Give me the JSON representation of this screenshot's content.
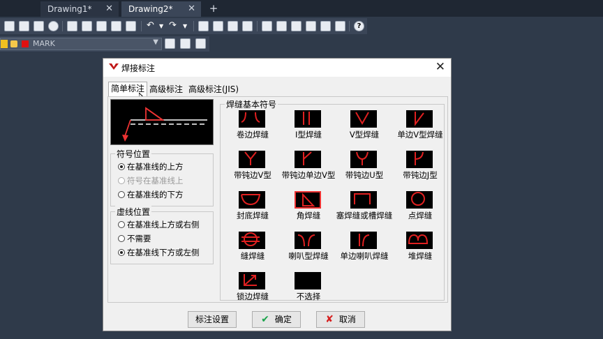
{
  "tabs": [
    {
      "label": "Drawing1*",
      "active": false
    },
    {
      "label": "Drawing2*",
      "active": true
    }
  ],
  "new_tab_label": "+",
  "layer": {
    "name": "MARK",
    "color": "#e01010"
  },
  "dialog": {
    "title": "焊接标注",
    "close": "✕",
    "tabs": [
      "简单标注",
      "高级标注",
      "高级标注(JIS)"
    ],
    "symbol_position": {
      "legend": "符号位置",
      "options": [
        {
          "label": "在基准线的上方",
          "checked": true,
          "disabled": false
        },
        {
          "label": "符号在基准线上",
          "checked": false,
          "disabled": true
        },
        {
          "label": "在基准线的下方",
          "checked": false,
          "disabled": false
        }
      ]
    },
    "dashed_position": {
      "legend": "虚线位置",
      "options": [
        {
          "label": "在基准线上方或右侧",
          "checked": false
        },
        {
          "label": "不需要",
          "checked": false
        },
        {
          "label": "在基准线下方或左侧",
          "checked": true
        }
      ]
    },
    "symbols_legend": "焊缝基本符号",
    "symbols": [
      {
        "label": "卷边焊缝",
        "icon": "flange-weld-icon"
      },
      {
        "label": "I型焊缝",
        "icon": "i-weld-icon"
      },
      {
        "label": "V型焊缝",
        "icon": "v-weld-icon"
      },
      {
        "label": "单边V型焊缝",
        "icon": "bevel-weld-icon"
      },
      {
        "label": "带钝边V型",
        "icon": "y-weld-icon"
      },
      {
        "label": "带钝边单边V型",
        "icon": "bevel-root-weld-icon"
      },
      {
        "label": "带钝边U型",
        "icon": "u-weld-icon"
      },
      {
        "label": "带钝边J型",
        "icon": "j-weld-icon"
      },
      {
        "label": "封底焊缝",
        "icon": "backing-weld-icon"
      },
      {
        "label": "角焊缝",
        "icon": "fillet-weld-icon",
        "selected": true
      },
      {
        "label": "塞焊缝或槽焊缝",
        "icon": "plug-weld-icon"
      },
      {
        "label": "点焊缝",
        "icon": "spot-weld-icon"
      },
      {
        "label": "缝焊缝",
        "icon": "seam-weld-icon"
      },
      {
        "label": "喇叭型焊缝",
        "icon": "flare-v-weld-icon"
      },
      {
        "label": "单边喇叭焊缝",
        "icon": "flare-bevel-weld-icon"
      },
      {
        "label": "堆焊缝",
        "icon": "surfacing-weld-icon"
      },
      {
        "label": "锁边焊缝",
        "icon": "lock-edge-weld-icon"
      },
      {
        "label": "不选择",
        "icon": "none-icon"
      }
    ],
    "buttons": {
      "settings": "标注设置",
      "ok": "确定",
      "cancel": "取消"
    }
  }
}
